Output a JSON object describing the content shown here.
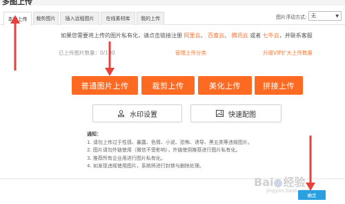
{
  "title": "多图上传",
  "tabs": [
    {
      "label": "本地上传"
    },
    {
      "label": "裁剪图片"
    },
    {
      "label": "插入远程图片"
    },
    {
      "label": "在线素材库"
    },
    {
      "label": "我的上传"
    }
  ],
  "float": {
    "label": "图片浮动方式:",
    "value": "无"
  },
  "register": {
    "prefix": "如果您需要将上传的图片私有化，请点击链接注册",
    "aliyun": "阿里云",
    "baidu": "百度云",
    "tencent": "腾讯云",
    "or": "或者",
    "qiniu": "七牛云",
    "suffix": "，并联系客服"
  },
  "count": {
    "label": "已上传图片数量：",
    "value": "0/100"
  },
  "manage_label": "管理上传分类",
  "vip_label": "升级VIP扩大上传数量",
  "buttons": {
    "normal_upload": "普通图片上传",
    "crop_upload": "裁剪上传",
    "beautify_upload": "美化上传",
    "splice_upload": "拼接上传",
    "watermark": "水印设置",
    "quick_image": "快速配图"
  },
  "notice": {
    "title": "通知：",
    "items": [
      "1. 请勿上传过于性感、暴露、色情、小说、恐怖、诱导、黑五类等违规图片。",
      "2. 图片请勿外链使用（微信不受影响），外链使用推荐进行图片私有化。",
      "3. 推荐所有企业用进行图片私有化。",
      "4. 如发现违规使用图片，系统将进行封禁与删除处理。"
    ]
  },
  "confirm_label": "确定",
  "watermark_text": {
    "brand": "Bai",
    "brand2": "经验",
    "sub": "jingyan.baidu.com"
  },
  "colors": {
    "accent": "#ff6a23",
    "confirm": "#2ba0e0",
    "arrow": "#e8413b"
  }
}
